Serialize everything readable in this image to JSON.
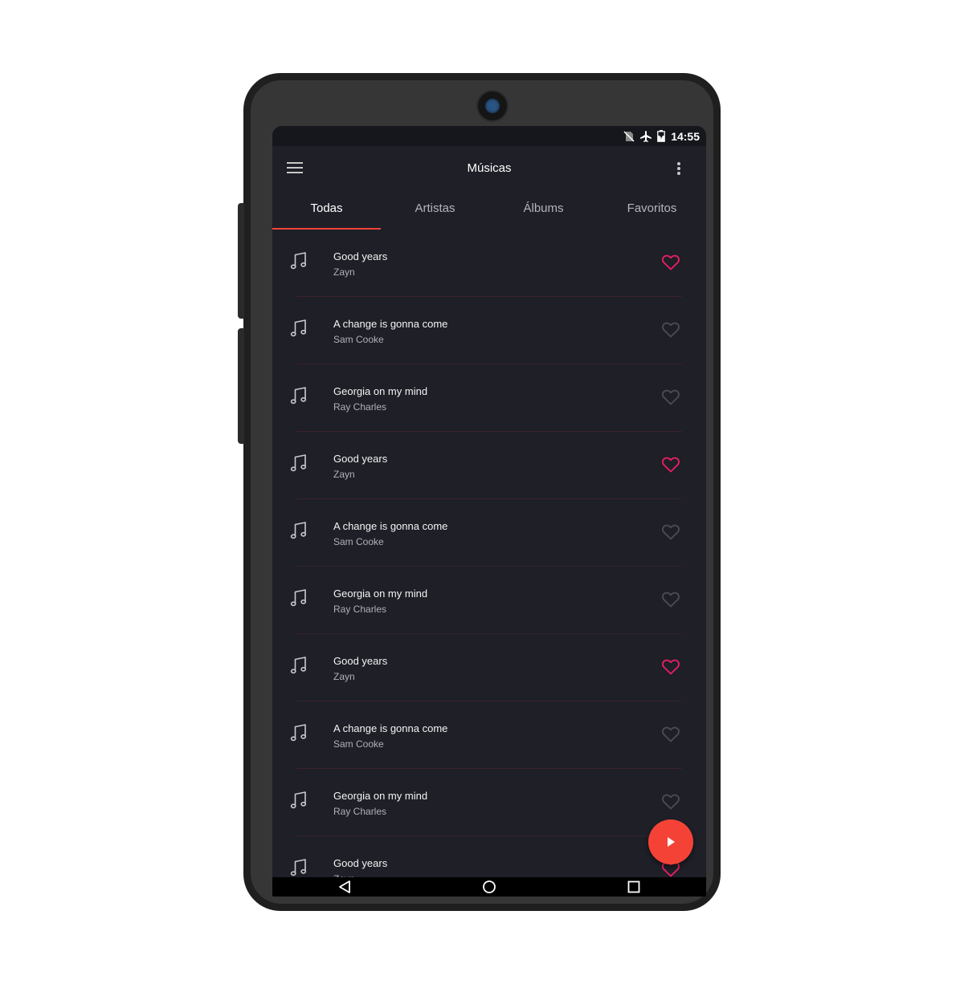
{
  "status_bar": {
    "time": "14:55",
    "icons": [
      "no-sim-icon",
      "airplane-mode-icon",
      "battery-charging-icon"
    ]
  },
  "app_bar": {
    "title": "Músicas",
    "menu_icon": "hamburger-menu-icon",
    "overflow_icon": "more-vert-icon"
  },
  "tabs": [
    {
      "label": "Todas",
      "active": true
    },
    {
      "label": "Artistas",
      "active": false
    },
    {
      "label": "Álbums",
      "active": false
    },
    {
      "label": "Favoritos",
      "active": false
    }
  ],
  "songs": [
    {
      "title": "Good years",
      "artist": "Zayn",
      "favorite": true
    },
    {
      "title": "A change is gonna come",
      "artist": "Sam Cooke",
      "favorite": false
    },
    {
      "title": "Georgia on my mind",
      "artist": "Ray Charles",
      "favorite": false
    },
    {
      "title": "Good years",
      "artist": "Zayn",
      "favorite": true
    },
    {
      "title": "A change is gonna come",
      "artist": "Sam Cooke",
      "favorite": false
    },
    {
      "title": "Georgia on my mind",
      "artist": "Ray Charles",
      "favorite": false
    },
    {
      "title": "Good years",
      "artist": "Zayn",
      "favorite": true
    },
    {
      "title": "A change is gonna come",
      "artist": "Sam Cooke",
      "favorite": false
    },
    {
      "title": "Georgia on my mind",
      "artist": "Ray Charles",
      "favorite": false
    },
    {
      "title": "Good years",
      "artist": "Zayn",
      "favorite": true
    }
  ],
  "fab": {
    "icon": "play-icon"
  },
  "nav_bar": {
    "icons": [
      "back-icon",
      "home-icon",
      "recents-icon"
    ]
  },
  "colors": {
    "background": "#1e1f27",
    "accent": "#f44336",
    "favorite": "#e91e63",
    "heart_inactive": "#4a4c54"
  }
}
